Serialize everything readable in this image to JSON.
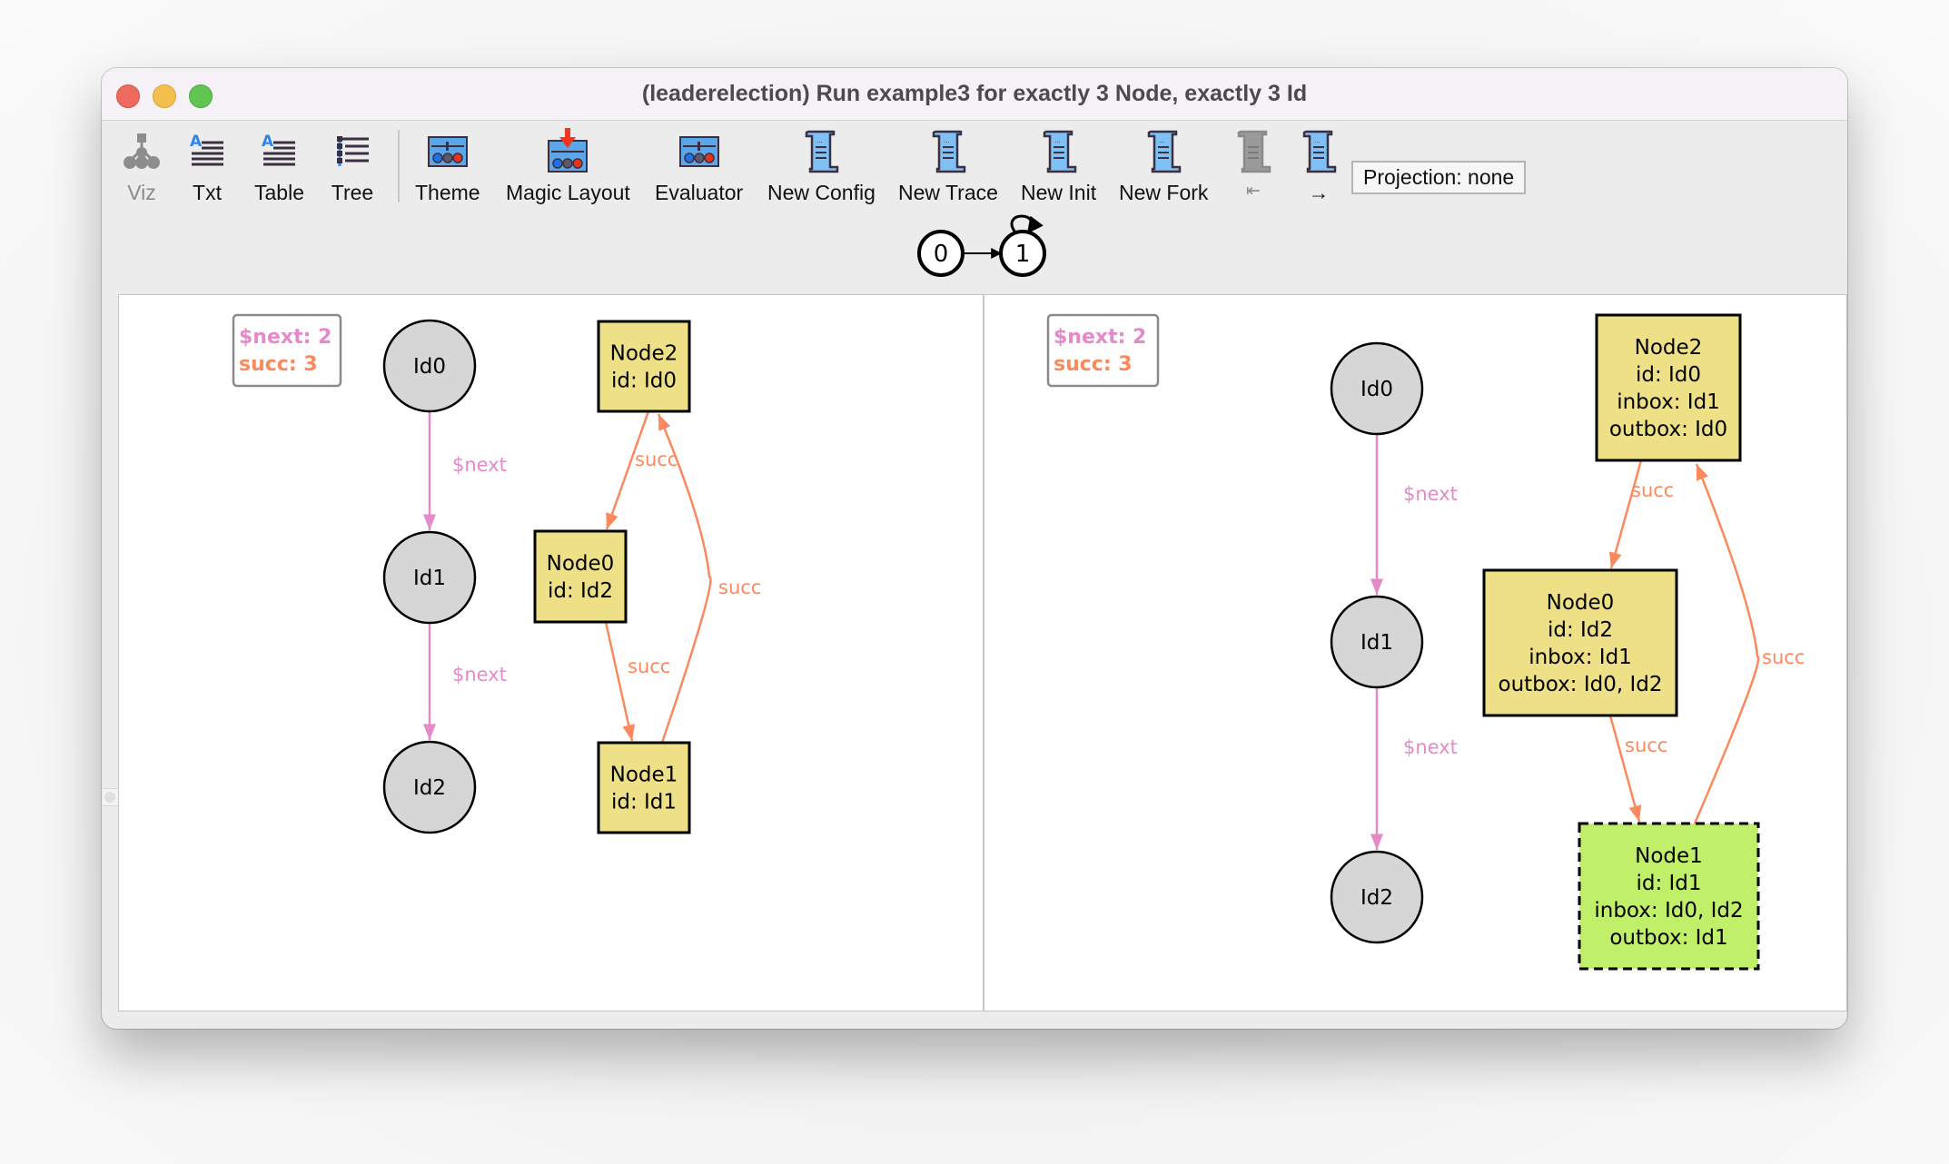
{
  "window": {
    "title": "(leaderelection) Run example3 for exactly 3 Node, exactly 3 Id"
  },
  "toolbar": {
    "buttons": [
      {
        "id": "viz",
        "label": "Viz",
        "icon": "viz-tree-icon",
        "enabled": false
      },
      {
        "id": "txt",
        "label": "Txt",
        "icon": "text-doc-icon",
        "enabled": true
      },
      {
        "id": "table",
        "label": "Table",
        "icon": "table-doc-icon",
        "enabled": true
      },
      {
        "id": "tree",
        "label": "Tree",
        "icon": "tree-list-icon",
        "enabled": true
      },
      {
        "id": "theme",
        "label": "Theme",
        "icon": "theme-sliders-icon",
        "enabled": true
      },
      {
        "id": "magic-layout",
        "label": "Magic Layout",
        "icon": "magic-layout-icon",
        "enabled": true
      },
      {
        "id": "evaluator",
        "label": "Evaluator",
        "icon": "evaluator-sliders-icon",
        "enabled": true
      },
      {
        "id": "new-config",
        "label": "New Config",
        "icon": "scroll-icon",
        "enabled": true
      },
      {
        "id": "new-trace",
        "label": "New Trace",
        "icon": "scroll-icon",
        "enabled": true
      },
      {
        "id": "new-init",
        "label": "New Init",
        "icon": "scroll-icon",
        "enabled": true
      },
      {
        "id": "new-fork",
        "label": "New Fork",
        "icon": "scroll-icon",
        "enabled": true
      },
      {
        "id": "first-state",
        "label": "⇤",
        "icon": "scroll-icon",
        "enabled": false
      },
      {
        "id": "next-state",
        "label": "→",
        "icon": "scroll-icon",
        "enabled": true
      }
    ],
    "projection_label": "Projection: none"
  },
  "state_graph": {
    "states": [
      "0",
      "1"
    ],
    "current": "1",
    "transitions": [
      [
        "0",
        "1"
      ],
      [
        "1",
        "1"
      ]
    ]
  },
  "colors": {
    "next_edge": "#e58ac8",
    "succ_edge": "#fa8a5e",
    "id_fill": "#d6d6d6",
    "node_fill": "#eee086",
    "node_highlight_fill": "#c0ef6a"
  },
  "panels": [
    {
      "name": "left",
      "legend": [
        {
          "text": "$next: 2",
          "color": "#e58ac8"
        },
        {
          "text": "succ: 3",
          "color": "#fa8a5e"
        }
      ],
      "ids": [
        "Id0",
        "Id1",
        "Id2"
      ],
      "next_edges": [
        {
          "from": "Id0",
          "to": "Id1",
          "label": "$next"
        },
        {
          "from": "Id1",
          "to": "Id2",
          "label": "$next"
        }
      ],
      "nodes": [
        {
          "name": "Node2",
          "lines": [
            "Node2",
            "id: Id0"
          ],
          "highlight": false
        },
        {
          "name": "Node0",
          "lines": [
            "Node0",
            "id: Id2"
          ],
          "highlight": false
        },
        {
          "name": "Node1",
          "lines": [
            "Node1",
            "id: Id1"
          ],
          "highlight": false
        }
      ],
      "succ_edges": [
        {
          "from": "Node2",
          "to": "Node0",
          "label": "succ"
        },
        {
          "from": "Node0",
          "to": "Node1",
          "label": "succ"
        },
        {
          "from": "Node1",
          "to": "Node2",
          "label": "succ"
        }
      ]
    },
    {
      "name": "right",
      "legend": [
        {
          "text": "$next: 2",
          "color": "#e58ac8"
        },
        {
          "text": "succ: 3",
          "color": "#fa8a5e"
        }
      ],
      "ids": [
        "Id0",
        "Id1",
        "Id2"
      ],
      "next_edges": [
        {
          "from": "Id0",
          "to": "Id1",
          "label": "$next"
        },
        {
          "from": "Id1",
          "to": "Id2",
          "label": "$next"
        }
      ],
      "nodes": [
        {
          "name": "Node2",
          "lines": [
            "Node2",
            "id: Id0",
            "inbox: Id1",
            "outbox: Id0"
          ],
          "highlight": false
        },
        {
          "name": "Node0",
          "lines": [
            "Node0",
            "id: Id2",
            "inbox: Id1",
            "outbox: Id0, Id2"
          ],
          "highlight": false
        },
        {
          "name": "Node1",
          "lines": [
            "Node1",
            "id: Id1",
            "inbox: Id0, Id2",
            "outbox: Id1"
          ],
          "highlight": true
        }
      ],
      "succ_edges": [
        {
          "from": "Node2",
          "to": "Node0",
          "label": "succ"
        },
        {
          "from": "Node0",
          "to": "Node1",
          "label": "succ"
        },
        {
          "from": "Node1",
          "to": "Node2",
          "label": "succ"
        }
      ]
    }
  ]
}
